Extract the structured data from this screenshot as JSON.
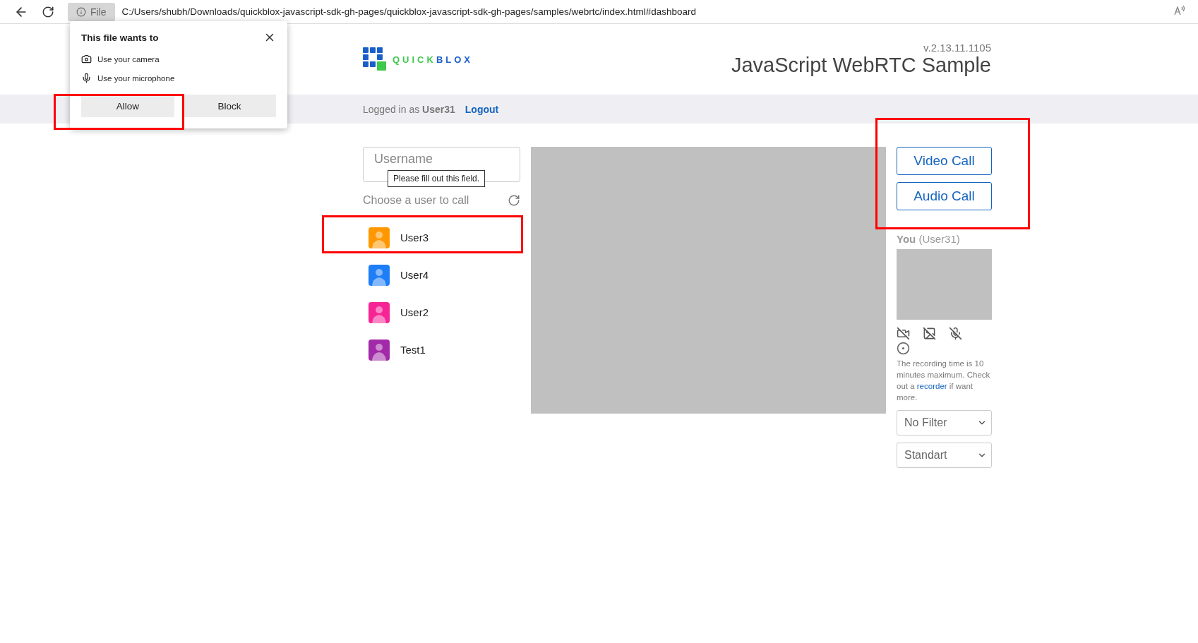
{
  "browser": {
    "site_badge": "File",
    "url": "C:/Users/shubh/Downloads/quickblox-javascript-sdk-gh-pages/quickblox-javascript-sdk-gh-pages/samples/webrtc/index.html#dashboard"
  },
  "permission_popup": {
    "title": "This file wants to",
    "items": [
      {
        "kind": "camera",
        "label": "Use your camera"
      },
      {
        "kind": "microphone",
        "label": "Use your microphone"
      }
    ],
    "buttons": [
      "Allow",
      "Block"
    ]
  },
  "header": {
    "logo_left": "QUICK",
    "logo_right": "BLOX",
    "version": "v.2.13.11.1105",
    "title": "JavaScript WebRTC Sample"
  },
  "session_bar": {
    "prefix": "Logged in as",
    "user": "User31",
    "logout": "Logout"
  },
  "username_field": {
    "placeholder": "Username",
    "tooltip": "Please fill out this field."
  },
  "users_heading": "Choose a user to call",
  "users": [
    {
      "name": "User3",
      "color": "#ff9800"
    },
    {
      "name": "User4",
      "color": "#1e7ef7"
    },
    {
      "name": "User2",
      "color": "#f72495"
    },
    {
      "name": "Test1",
      "color": "#a22aa8"
    }
  ],
  "call_buttons": [
    "Video Call",
    "Audio Call"
  ],
  "self_view": {
    "label": "You",
    "user": "(User31)"
  },
  "recording_note": {
    "before": "The recording time is 10 minutes maximum. Check out a",
    "link": "recorder",
    "after": "if want more."
  },
  "selects": [
    {
      "value": "No Filter"
    },
    {
      "value": "Standart"
    }
  ]
}
